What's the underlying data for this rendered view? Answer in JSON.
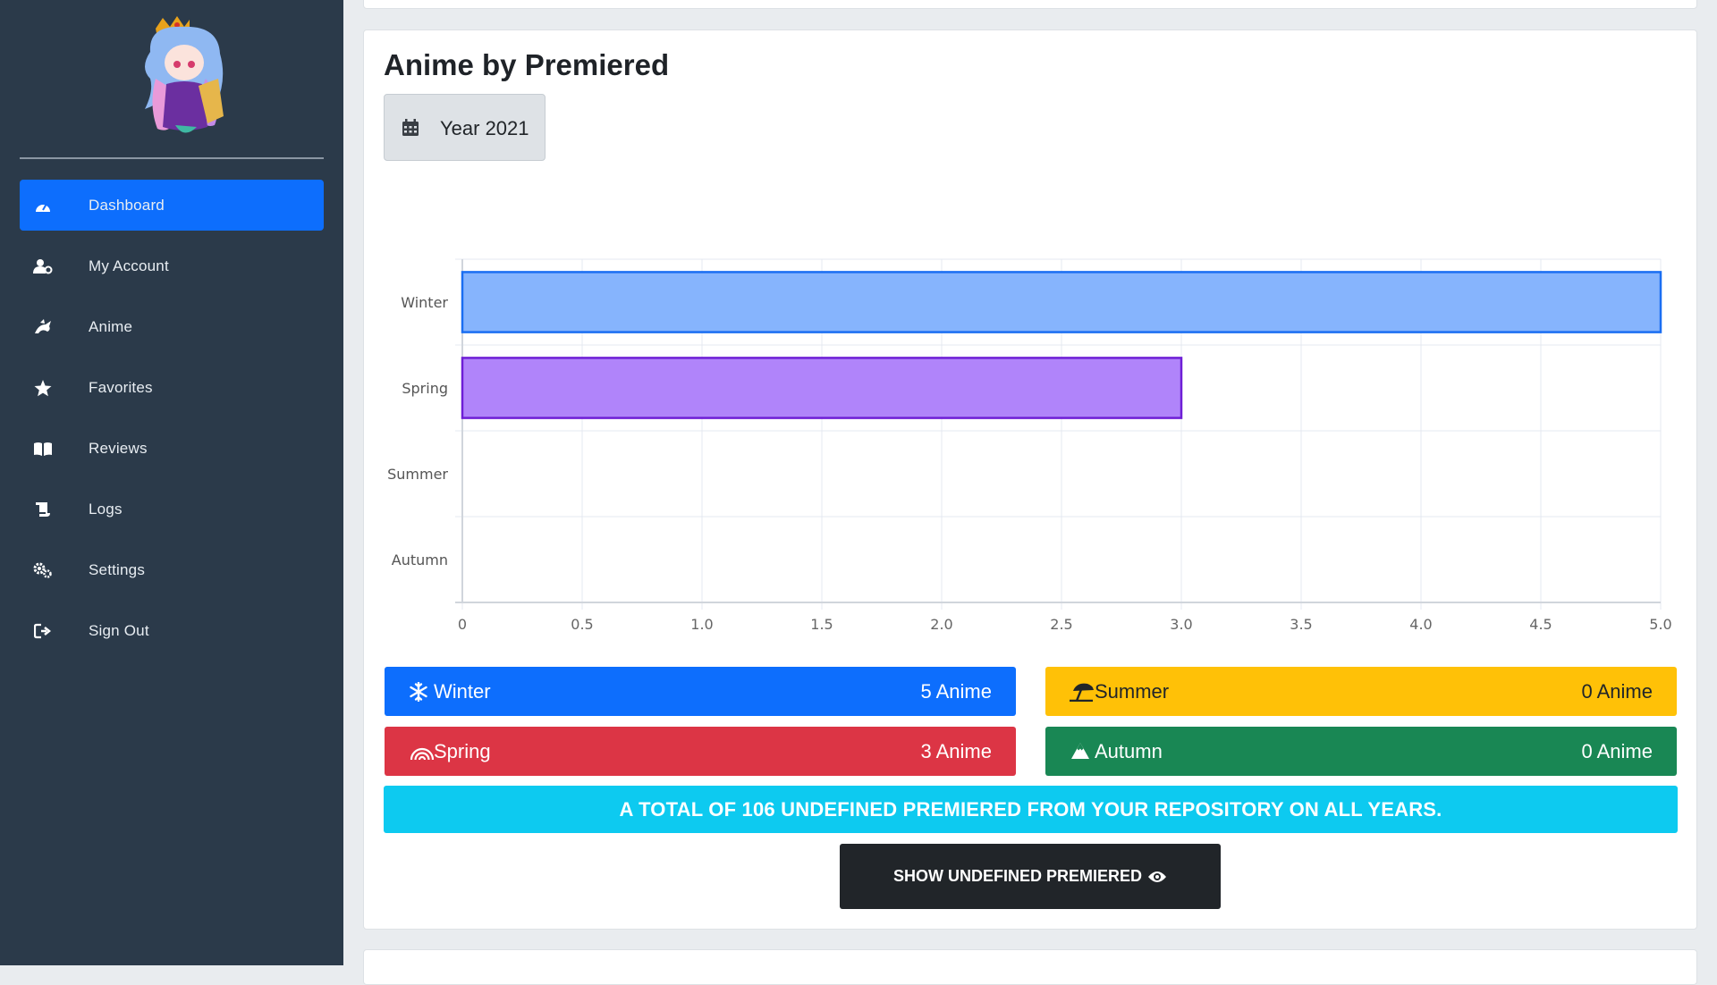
{
  "sidebar": {
    "items": [
      {
        "label": "Dashboard",
        "icon": "dashboard-icon",
        "active": true
      },
      {
        "label": "My Account",
        "icon": "user-gear-icon"
      },
      {
        "label": "Anime",
        "icon": "dragon-icon"
      },
      {
        "label": "Favorites",
        "icon": "star-icon"
      },
      {
        "label": "Reviews",
        "icon": "book-open-icon"
      },
      {
        "label": "Logs",
        "icon": "scroll-icon"
      },
      {
        "label": "Settings",
        "icon": "gears-icon"
      },
      {
        "label": "Sign Out",
        "icon": "sign-out-icon"
      }
    ]
  },
  "main": {
    "title": "Anime by Premiered",
    "year_button": "Year 2021",
    "seasons": {
      "winter": {
        "name": "Winter",
        "count": "5 Anime",
        "icon": "snowflake-icon"
      },
      "summer": {
        "name": "Summer",
        "count": "0 Anime",
        "icon": "umbrella-beach-icon"
      },
      "spring": {
        "name": "Spring",
        "count": "3 Anime",
        "icon": "rainbow-icon"
      },
      "autumn": {
        "name": "Autumn",
        "count": "0 Anime",
        "icon": "mountain-icon"
      }
    },
    "total_banner": "A TOTAL OF 106 UNDEFINED PREMIERED FROM YOUR REPOSITORY ON ALL YEARS.",
    "show_button": "SHOW UNDEFINED PREMIERED"
  },
  "colors": {
    "sidebar_bg": "#2b3a4a",
    "primary": "#0d6efd",
    "warning": "#ffc107",
    "danger": "#dc3545",
    "success": "#198754",
    "info": "#0dcaf0",
    "dark": "#212529"
  },
  "chart_data": {
    "type": "bar",
    "orientation": "horizontal",
    "categories": [
      "Winter",
      "Spring",
      "Summer",
      "Autumn"
    ],
    "values": [
      5,
      3,
      0,
      0
    ],
    "bar_fill_colors": [
      "#86b4fd",
      "#b084fa",
      "#ffe08a",
      "#9ad1b5"
    ],
    "bar_border_colors": [
      "#1a6ef2",
      "#6e1fd6",
      "#ffc107",
      "#198754"
    ],
    "xlim": [
      0,
      5
    ],
    "xticks": [
      "0",
      "0.5",
      "1.0",
      "1.5",
      "2.0",
      "2.5",
      "3.0",
      "3.5",
      "4.0",
      "4.5",
      "5.0"
    ],
    "grid": true
  }
}
